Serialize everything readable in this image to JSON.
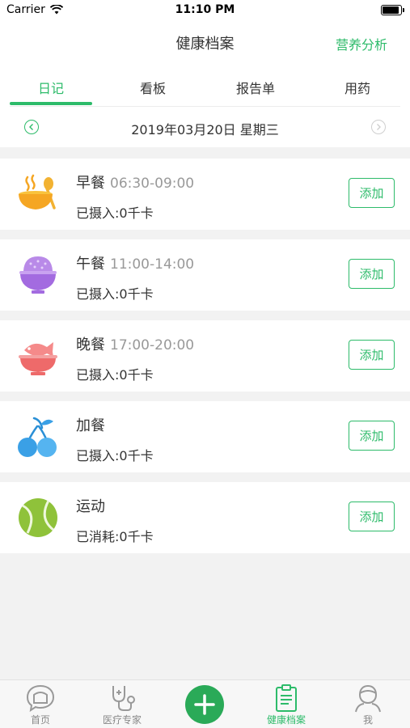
{
  "status_bar": {
    "carrier": "Carrier",
    "time": "11:10 PM"
  },
  "nav": {
    "title": "健康档案",
    "right_action": "营养分析"
  },
  "tabs": [
    {
      "label": "日记",
      "active": true
    },
    {
      "label": "看板",
      "active": false
    },
    {
      "label": "报告单",
      "active": false
    },
    {
      "label": "用药",
      "active": false
    }
  ],
  "date": {
    "text": "2019年03月20日 星期三"
  },
  "meals": [
    {
      "title": "早餐",
      "time": "06:30-09:00",
      "status": "已摄入:0千卡",
      "icon": "breakfast-bowl-icon",
      "add_label": "添加"
    },
    {
      "title": "午餐",
      "time": "11:00-14:00",
      "status": "已摄入:0千卡",
      "icon": "lunch-rice-bowl-icon",
      "add_label": "添加"
    },
    {
      "title": "晚餐",
      "time": "17:00-20:00",
      "status": "已摄入:0千卡",
      "icon": "dinner-fish-bowl-icon",
      "add_label": "添加"
    },
    {
      "title": "加餐",
      "time": "",
      "status": "已摄入:0千卡",
      "icon": "snack-cherry-icon",
      "add_label": "添加"
    },
    {
      "title": "运动",
      "time": "",
      "status": "已消耗:0千卡",
      "icon": "exercise-tennis-ball-icon",
      "add_label": "添加"
    }
  ],
  "tabbar": [
    {
      "label": "首页",
      "icon": "home-chat-icon",
      "active": false
    },
    {
      "label": "医疗专家",
      "icon": "stethoscope-icon",
      "active": false
    },
    {
      "label": "",
      "icon": "plus-icon",
      "active": false
    },
    {
      "label": "健康档案",
      "icon": "clipboard-icon",
      "active": true
    },
    {
      "label": "我",
      "icon": "person-icon",
      "active": false
    }
  ],
  "colors": {
    "accent": "#2dbb6a",
    "background": "#f2f2f2"
  }
}
